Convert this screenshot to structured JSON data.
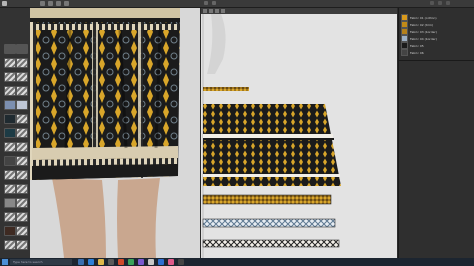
{
  "menubar": {
    "app_title": "",
    "label_mid": "",
    "label_right": ""
  },
  "browser": {
    "items": [
      {
        "label": "Fabric 01 (cotton)"
      },
      {
        "label": "Fabric 02 (trim)"
      },
      {
        "label": "Fabric 03 (border)"
      },
      {
        "label": "Fabric 04 (border)"
      },
      {
        "label": "Fabric 05"
      },
      {
        "label": "Fabric 06"
      }
    ]
  },
  "taskbar": {
    "search_placeholder": "Type here to search",
    "clock_time": "",
    "clock_date": ""
  },
  "colors": {
    "fabric_black": "#1b1b1b",
    "fabric_gold": "#d9a62a",
    "fabric_white": "#e8e8e8",
    "trim_blue": "#9db0c4",
    "canvas_bg": "#e3e3e3"
  }
}
